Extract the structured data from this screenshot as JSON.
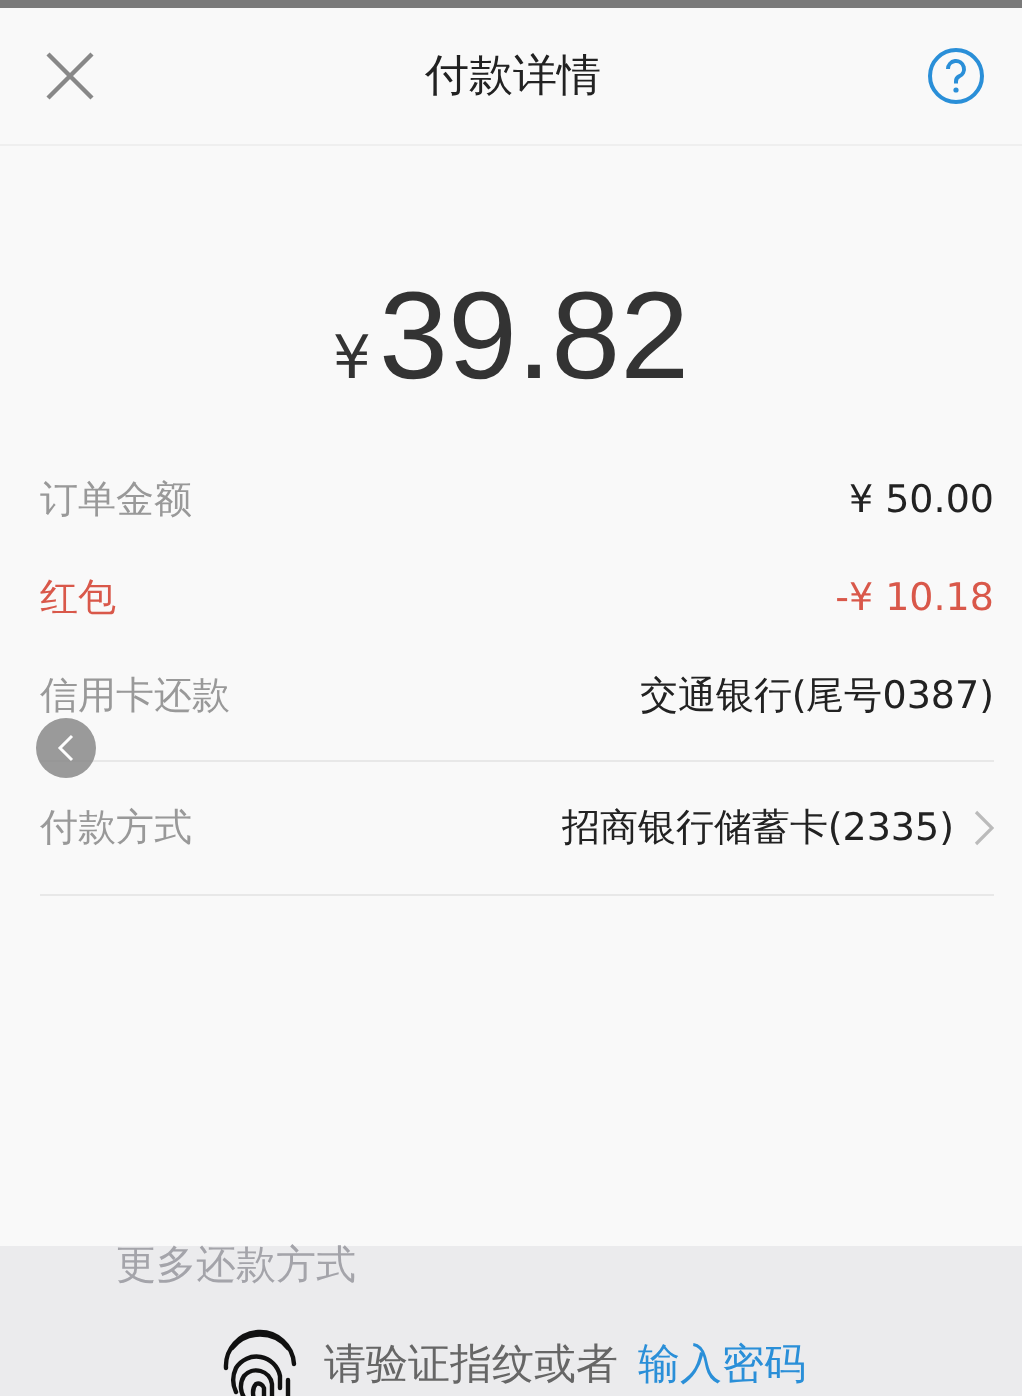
{
  "header": {
    "title": "付款详情"
  },
  "amount": {
    "currency": "¥",
    "value": "39.82"
  },
  "rows": [
    {
      "kind": "plain",
      "label": "订单金额",
      "value": "¥ 50.00"
    },
    {
      "kind": "discount",
      "label": "红包",
      "value": "-¥ 10.18"
    },
    {
      "kind": "plain",
      "label": "信用卡还款",
      "value": "交通银行(尾号0387)"
    },
    {
      "kind": "selectable",
      "label": "付款方式",
      "value": "招商银行储蓄卡(2335)"
    }
  ],
  "more_options": "更多还款方式",
  "verify": {
    "prompt": "请验证指纹或者",
    "link": "输入密码"
  }
}
